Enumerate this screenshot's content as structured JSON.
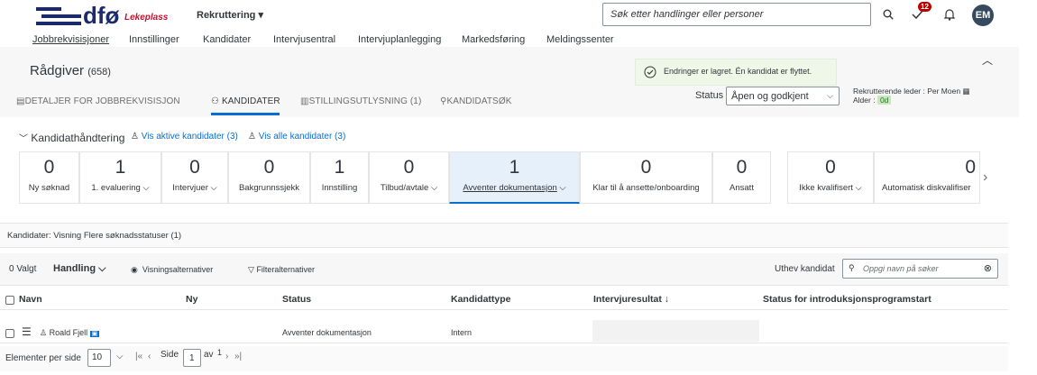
{
  "header": {
    "brand": "dfø",
    "brand_sub": "Lekeplass",
    "module_menu": "Rekruttering",
    "search_placeholder": "Søk etter handlinger eller personer",
    "notification_count": "12",
    "user_initials": "EM"
  },
  "nav": [
    "Jobbrekvisisjoner",
    "Innstillinger",
    "Kandidater",
    "Intervjusentral",
    "Intervjuplanlegging",
    "Markedsføring",
    "Meldingssenter"
  ],
  "page": {
    "title": "Rådgiver",
    "title_count": "(658)",
    "toast": "Endringer er lagret. Én kandidat er flyttet.",
    "tabs": [
      "DETALJER FOR JOBBREKVISISJON",
      "KANDIDATER",
      "STILLINGSUTLYSNING (1)",
      "KANDIDATSØK"
    ],
    "status_label": "Status",
    "status_value": "Åpen og godkjent",
    "meta_line1": "Rekrutterende leder : Per Moen",
    "meta_age_label": "Alder :",
    "meta_age_value": "0d"
  },
  "candidate_handling": {
    "title": "Kandidathåndtering",
    "link_active": "Vis aktive kandidater (3)",
    "link_all": "Vis alle kandidater (3)",
    "tiles": [
      {
        "count": "0",
        "label": "Ny søknad"
      },
      {
        "count": "1",
        "label": "1. evaluering"
      },
      {
        "count": "0",
        "label": "Intervjuer"
      },
      {
        "count": "0",
        "label": "Bakgrunnssjekk"
      },
      {
        "count": "1",
        "label": "Innstilling"
      },
      {
        "count": "0",
        "label": "Tilbud/avtale"
      },
      {
        "count": "1",
        "label": "Avventer dokumentasjon"
      },
      {
        "count": "0",
        "label": "Klar til å ansette/onboarding"
      },
      {
        "count": "0",
        "label": "Ansatt"
      },
      {
        "count": "0",
        "label": "Ikke kvalifisert"
      },
      {
        "count": "0",
        "label": "Automatisk diskvalifiser"
      }
    ]
  },
  "table": {
    "caption": "Kandidater: Visning Flere søknadsstatuser (1)",
    "selected": "0 Valgt",
    "action": "Handling",
    "view_options": "Visningsalternativer",
    "filter_options": "Filteralternativer",
    "highlight_label": "Uthev kandidat",
    "highlight_placeholder": "Oppgi navn på søker",
    "columns": [
      "Navn",
      "Ny",
      "Status",
      "Kandidattype",
      "Intervjuresultat",
      "Status for introduksjonsprogramstart"
    ],
    "rows": [
      {
        "name": "Roald Fjell",
        "new": "",
        "status": "Avventer dokumentasjon",
        "type": "Intern",
        "interview": "",
        "intro": ""
      }
    ]
  },
  "pager": {
    "per_page_label": "Elementer per side",
    "per_page_value": "10",
    "page_label": "Side",
    "page_value": "1",
    "of_label": "av",
    "total_pages": "1"
  }
}
